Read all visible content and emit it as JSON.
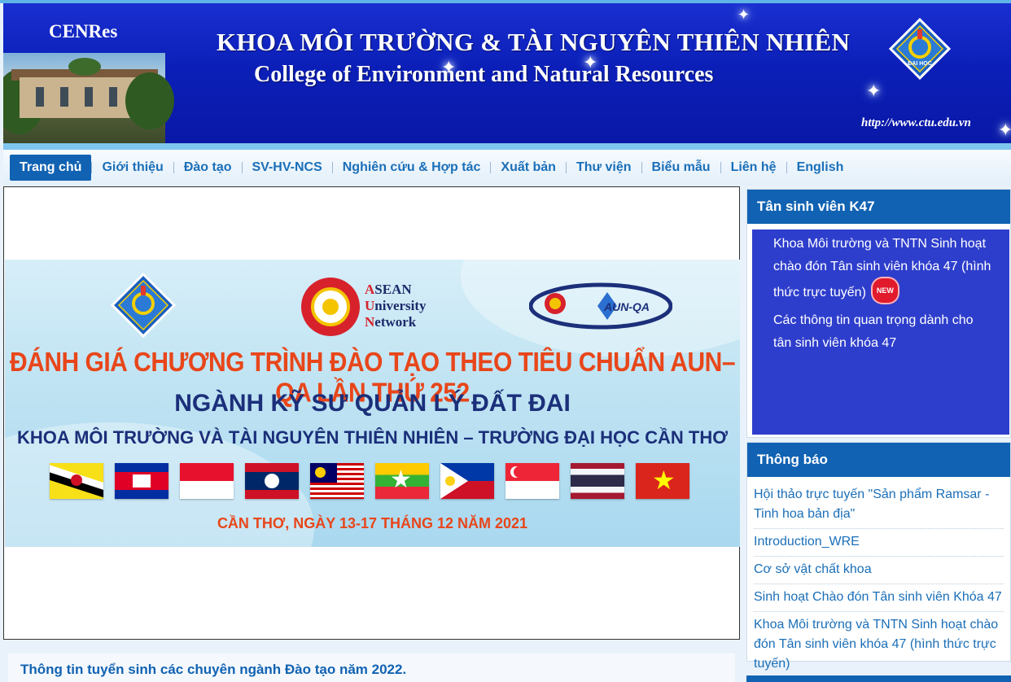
{
  "header": {
    "logo_text": "CENRes",
    "title_vi": "KHOA MÔI TRƯỜNG & TÀI NGUYÊN THIÊN NHIÊN",
    "title_en": "College of  Environment and Natural Resources",
    "url": "http://www.ctu.edu.vn"
  },
  "nav": {
    "items": [
      {
        "label": "Trang chủ"
      },
      {
        "label": "Giới thiệu"
      },
      {
        "label": "Đào tạo"
      },
      {
        "label": "SV-HV-NCS"
      },
      {
        "label": "Nghiên cứu & Hợp tác"
      },
      {
        "label": "Xuất bản"
      },
      {
        "label": "Thư viện"
      },
      {
        "label": "Biểu mẫu"
      },
      {
        "label": "Liên hệ"
      },
      {
        "label": "English"
      }
    ]
  },
  "slide": {
    "asean_lines": [
      "SEAN",
      "niversity",
      "etwork"
    ],
    "asean_initials": [
      "A",
      "U",
      "N"
    ],
    "aunqa_label": "AUN-QA",
    "heading1": "ĐÁNH GIÁ CHƯƠNG TRÌNH ĐÀO TẠO THEO TIÊU CHUẨN AUN–QA LẦN THỨ 252",
    "heading2": "NGÀNH KỸ SƯ QUẢN LÝ ĐẤT ĐAI",
    "heading3": "KHOA MÔI TRƯỜNG VÀ TÀI NGUYÊN THIÊN NHIÊN – TRƯỜNG ĐẠI HỌC CẦN THƠ",
    "date": "CẦN THƠ,  NGÀY 13-17 THÁNG 12 NĂM 2021"
  },
  "news": {
    "title": "Thông tin tuyển sinh các chuyên ngành Đào tạo năm 2022."
  },
  "k47": {
    "title": "Tân sinh viên K47",
    "links": [
      "Khoa Môi trường và TNTN Sinh hoạt chào đón Tân sinh viên khóa 47 (hình thức trực tuyến)",
      "Các thông tin quan trọng dành cho tân sinh viên khóa 47"
    ],
    "new_badge": "NEW"
  },
  "thongbao": {
    "title": "Thông báo",
    "items": [
      "Hội thảo trực tuyến \"Sản phẩm Ramsar - Tinh hoa bản địa\"",
      "Introduction_WRE",
      "Cơ sở vật chất khoa",
      "Sinh hoạt Chào đón Tân sinh viên Khóa 47",
      "Khoa Môi trường và TNTN Sinh hoạt chào đón Tân sinh viên khóa 47 (hình thức trực tuyến)"
    ]
  },
  "colors": {
    "banner_blue": "#0b1fb8",
    "nav_active": "#1162b2",
    "link_blue": "#1b6fb8",
    "k47_panel": "#2e3ecc",
    "accent_orange": "#e8461a"
  }
}
